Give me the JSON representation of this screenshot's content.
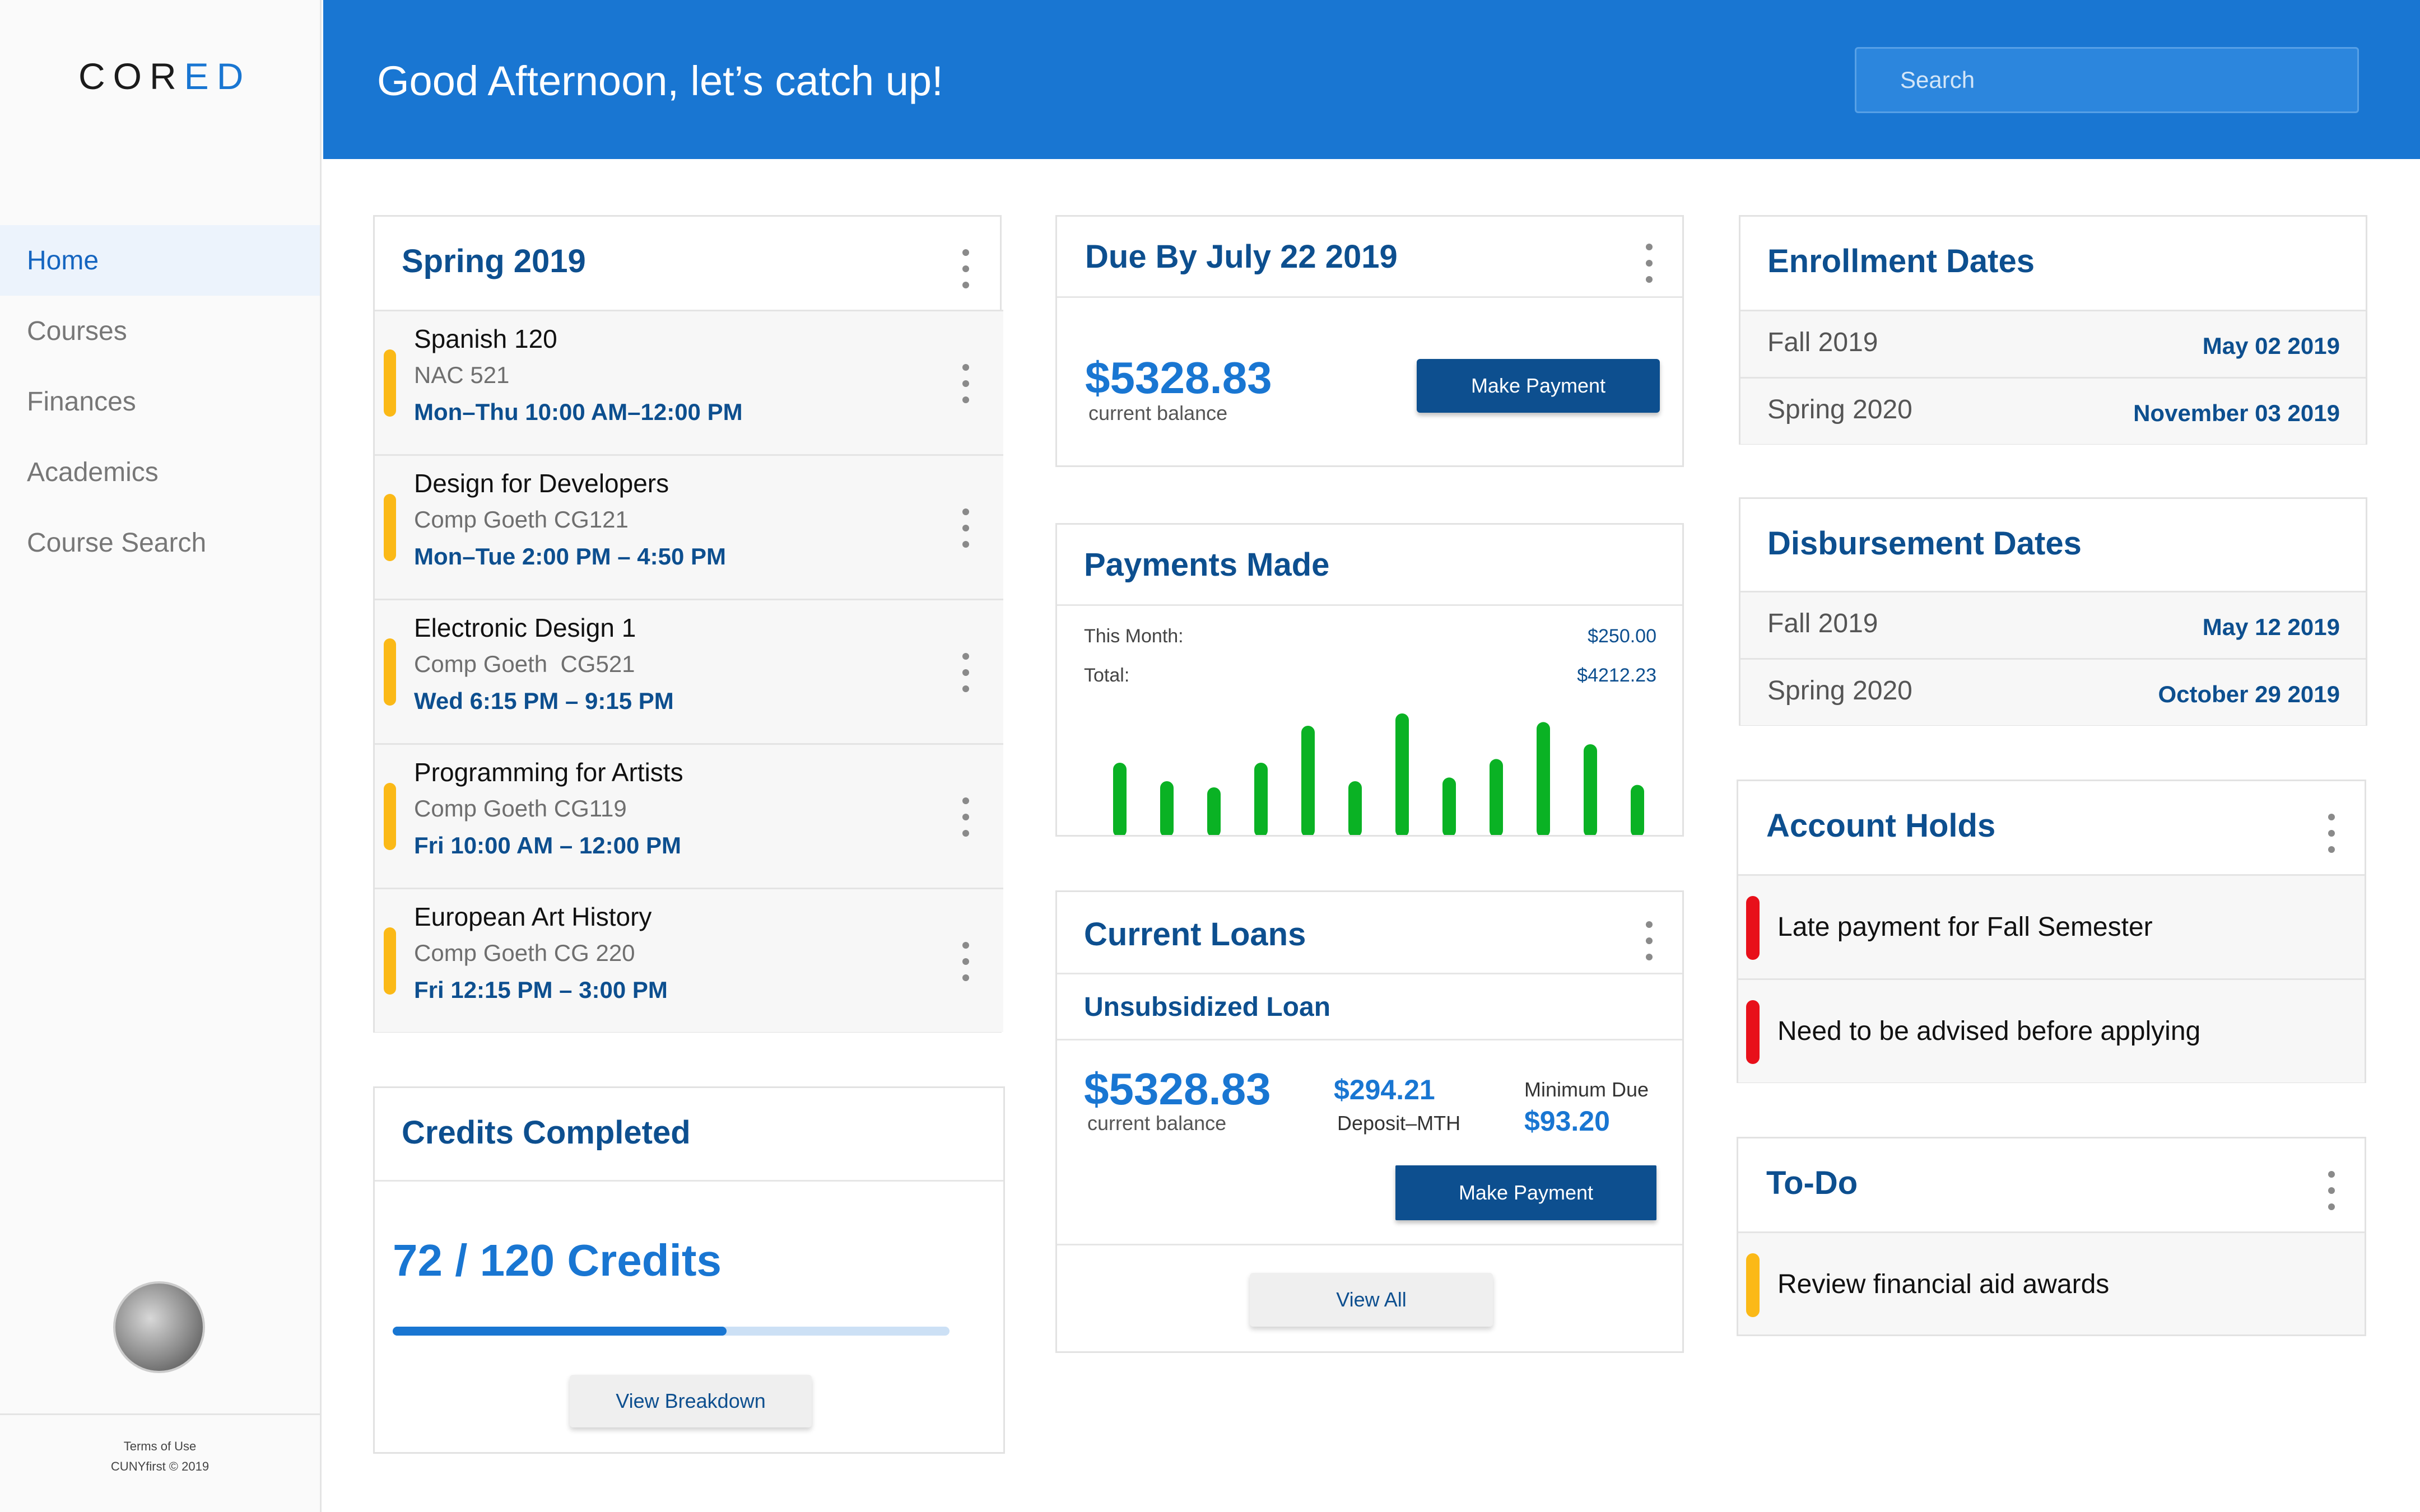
{
  "app": {
    "logo_left": "COR",
    "logo_right": "ED",
    "greeting": "Good Afternoon, let’s catch up!",
    "search_placeholder": "Search"
  },
  "colors": {
    "primary": "#1976d2",
    "dark_blue": "#0d4f8f",
    "course_bar": "#fbb917",
    "hold_bar": "#e8101a",
    "chart_bar": "#0ab224"
  },
  "sidebar": {
    "items": [
      {
        "label": "Home",
        "active": true
      },
      {
        "label": "Courses"
      },
      {
        "label": "Finances"
      },
      {
        "label": "Academics"
      },
      {
        "label": "Course Search"
      }
    ],
    "footer_terms": "Terms of Use",
    "footer_copy": "CUNYfirst © 2019"
  },
  "schedule": {
    "title": "Spring 2019",
    "courses": [
      {
        "name": "Spanish 120",
        "room": "NAC 521",
        "time": "Mon–Thu 10:00 AM–12:00 PM"
      },
      {
        "name": "Design for Developers",
        "room": "Comp Goeth CG121",
        "time": "Mon–Tue 2:00 PM – 4:50 PM"
      },
      {
        "name": "Electronic Design 1",
        "room": "Comp Goeth  CG521",
        "time": "Wed 6:15 PM – 9:15 PM"
      },
      {
        "name": "Programming for Artists",
        "room": "Comp Goeth CG119",
        "time": "Fri 10:00 AM – 12:00 PM"
      },
      {
        "name": "European Art History",
        "room": "Comp Goeth CG 220",
        "time": "Fri 12:15 PM – 3:00 PM"
      }
    ]
  },
  "credits": {
    "title": "Credits Completed",
    "value": "72 / 120 Credits",
    "completed": 72,
    "total": 120,
    "button": "View Breakdown"
  },
  "due": {
    "title": "Due By July 22 2019",
    "amount": "$5328.83",
    "caption": "current balance",
    "button": "Make Payment"
  },
  "payments": {
    "title": "Payments Made",
    "this_month_label": "This Month:",
    "this_month_value": "$250.00",
    "total_label": "Total:",
    "total_value": "$4212.23"
  },
  "chart_data": {
    "type": "bar",
    "values": [
      55,
      40,
      35,
      55,
      85,
      40,
      95,
      43,
      58,
      88,
      70,
      37
    ],
    "ylim": [
      0,
      100
    ]
  },
  "loans": {
    "title": "Current Loans",
    "subtitle": "Unsubsidized Loan",
    "amount": "$5328.83",
    "caption": "current balance",
    "deposit_value": "$294.21",
    "deposit_label": "Deposit–MTH",
    "min_label": "Minimum Due",
    "min_value": "$93.20",
    "pay_button": "Make Payment",
    "view_all": "View All"
  },
  "enrollment": {
    "title": "Enrollment Dates",
    "rows": [
      {
        "term": "Fall 2019",
        "date": "May 02 2019"
      },
      {
        "term": "Spring 2020",
        "date": "November 03 2019"
      }
    ]
  },
  "disbursement": {
    "title": "Disbursement Dates",
    "rows": [
      {
        "term": "Fall 2019",
        "date": "May 12 2019"
      },
      {
        "term": "Spring 2020",
        "date": "October 29 2019"
      }
    ]
  },
  "holds": {
    "title": "Account Holds",
    "items": [
      {
        "text": "Late payment for Fall Semester"
      },
      {
        "text": "Need to be advised before applying"
      }
    ]
  },
  "todo": {
    "title": "To-Do",
    "items": [
      {
        "text": "Review financial aid awards"
      }
    ]
  }
}
